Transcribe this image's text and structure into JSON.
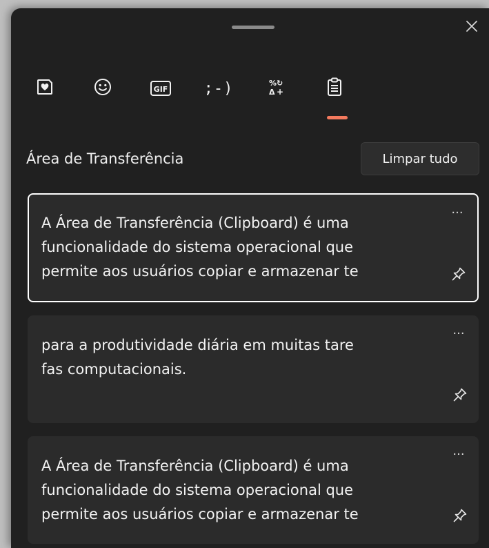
{
  "panel": {
    "close_icon": "close-icon"
  },
  "tabs": [
    {
      "name": "recently-used",
      "icon": "heart-sticker-icon"
    },
    {
      "name": "emoji",
      "icon": "smiley-icon"
    },
    {
      "name": "gif",
      "icon": "gif-icon",
      "label": "GIF"
    },
    {
      "name": "kaomoji",
      "icon": "kaomoji-icon",
      "label": ";-)"
    },
    {
      "name": "symbols",
      "icon": "symbols-icon",
      "label": "%↻Δ+"
    },
    {
      "name": "clipboard",
      "icon": "clipboard-icon",
      "active": true
    }
  ],
  "accent_color": "#f47a5e",
  "clipboard": {
    "title": "Área de Transferência",
    "clear_all_label": "Limpar tudo",
    "items": [
      {
        "text": "A Área de Transferência (Clipboard) é uma\nfuncionalidade do sistema operacional que\npermite aos usuários copiar e armazenar te",
        "selected": true,
        "more_label": "···",
        "pin_icon": "pin-icon"
      },
      {
        "text": "para a produtividade diária em muitas tare\nfas computacionais.",
        "selected": false,
        "more_label": "···",
        "pin_icon": "pin-icon"
      },
      {
        "text": "A Área de Transferência (Clipboard) é uma\nfuncionalidade do sistema operacional que\npermite aos usuários copiar e armazenar te",
        "selected": false,
        "more_label": "···",
        "pin_icon": "pin-icon"
      }
    ]
  }
}
